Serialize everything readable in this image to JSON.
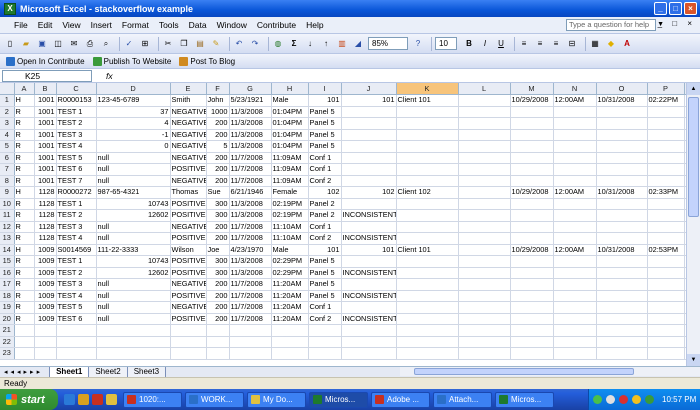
{
  "window": {
    "title": "Microsoft Excel - stackoverflow example"
  },
  "menu": [
    "File",
    "Edit",
    "View",
    "Insert",
    "Format",
    "Tools",
    "Data",
    "Window",
    "Contribute",
    "Help"
  ],
  "help_placeholder": "Type a question for help",
  "toolbar": {
    "zoom": "85%",
    "font_size": "10"
  },
  "contribute_bar": {
    "open": "Open In Contribute",
    "publish": "Publish To Website",
    "post": "Post To Blog"
  },
  "formula": {
    "name_box": "K25",
    "fx": "fx",
    "value": ""
  },
  "columns": [
    "A",
    "B",
    "C",
    "D",
    "E",
    "F",
    "G",
    "H",
    "I",
    "J",
    "K",
    "L",
    "M",
    "N",
    "O",
    "P",
    "Q"
  ],
  "selected_column": "K",
  "rows": [
    [
      "H",
      "1001",
      "R0000153",
      "123-45-6789",
      "Smith",
      "John",
      "5/23/1921",
      "Male",
      "101",
      "101",
      "Client 101",
      "",
      "10/29/2008",
      "12:00AM",
      "10/31/2008",
      "02:22PM",
      ""
    ],
    [
      "R",
      "1001",
      "TEST 1",
      "37",
      "NEGATIVE",
      "1000",
      "11/3/2008",
      "01:04PM",
      "Panel 5",
      "",
      "",
      "",
      "",
      "",
      "",
      "",
      ""
    ],
    [
      "R",
      "1001",
      "TEST 2",
      "4",
      "NEGATIVE",
      "200",
      "11/3/2008",
      "01:04PM",
      "Panel 5",
      "",
      "",
      "",
      "",
      "",
      "",
      "",
      ""
    ],
    [
      "R",
      "1001",
      "TEST 3",
      "-1",
      "NEGATIVE",
      "200",
      "11/3/2008",
      "01:04PM",
      "Panel 5",
      "",
      "",
      "",
      "",
      "",
      "",
      "",
      ""
    ],
    [
      "R",
      "1001",
      "TEST 4",
      "0",
      "NEGATIVE",
      "5",
      "11/3/2008",
      "01:04PM",
      "Panel 5",
      "",
      "",
      "",
      "",
      "",
      "",
      "",
      ""
    ],
    [
      "R",
      "1001",
      "TEST 5",
      "null",
      "NEGATIVE",
      "200",
      "11/7/2008",
      "11:09AM",
      "Conf 1",
      "",
      "",
      "",
      "",
      "",
      "",
      "",
      ""
    ],
    [
      "R",
      "1001",
      "TEST 6",
      "null",
      "POSITIVE",
      "200",
      "11/7/2008",
      "11:09AM",
      "Conf 1",
      "",
      "",
      "",
      "",
      "",
      "",
      "",
      ""
    ],
    [
      "R",
      "1001",
      "TEST 7",
      "null",
      "NEGATIVE",
      "200",
      "11/7/2008",
      "11:09AM",
      "Conf 2",
      "",
      "",
      "",
      "",
      "",
      "",
      "",
      ""
    ],
    [
      "H",
      "1128",
      "R0000272",
      "987-65-4321",
      "Thomas",
      "Sue",
      "6/21/1946",
      "Female",
      "102",
      "102",
      "Client 102",
      "",
      "10/29/2008",
      "12:00AM",
      "10/31/2008",
      "02:33PM",
      ""
    ],
    [
      "R",
      "1128",
      "TEST 1",
      "10743",
      "POSITIVE",
      "300",
      "11/3/2008",
      "02:19PM",
      "Panel 2",
      "",
      "",
      "",
      "",
      "",
      "",
      "",
      ""
    ],
    [
      "R",
      "1128",
      "TEST 2",
      "12602",
      "POSITIVE",
      "300",
      "11/3/2008",
      "02:19PM",
      "Panel 2",
      "INCONSISTENT",
      "",
      "",
      "",
      "",
      "",
      "",
      ""
    ],
    [
      "R",
      "1128",
      "TEST 3",
      "null",
      "NEGATIVE",
      "200",
      "11/7/2008",
      "11:10AM",
      "Conf 1",
      "",
      "",
      "",
      "",
      "",
      "",
      "",
      ""
    ],
    [
      "R",
      "1128",
      "TEST 4",
      "null",
      "POSITIVE",
      "200",
      "11/7/2008",
      "11:10AM",
      "Conf 2",
      "INCONSISTENT",
      "",
      "",
      "",
      "",
      "",
      "",
      ""
    ],
    [
      "H",
      "1009",
      "S0014569",
      "111-22-3333",
      "Wilson",
      "Joe",
      "4/23/1970",
      "Male",
      "101",
      "101",
      "Client 101",
      "",
      "10/29/2008",
      "12:00AM",
      "10/31/2008",
      "02:53PM",
      ""
    ],
    [
      "R",
      "1009",
      "TEST 1",
      "10743",
      "POSITIVE",
      "300",
      "11/3/2008",
      "02:29PM",
      "Panel 5",
      "",
      "",
      "",
      "",
      "",
      "",
      "",
      ""
    ],
    [
      "R",
      "1009",
      "TEST 2",
      "12602",
      "POSITIVE",
      "300",
      "11/3/2008",
      "02:29PM",
      "Panel 5",
      "INCONSISTENT",
      "",
      "",
      "",
      "",
      "",
      "",
      ""
    ],
    [
      "R",
      "1009",
      "TEST 3",
      "null",
      "NEGATIVE",
      "200",
      "11/7/2008",
      "11:20AM",
      "Panel 5",
      "",
      "",
      "",
      "",
      "",
      "",
      "",
      ""
    ],
    [
      "R",
      "1009",
      "TEST 4",
      "null",
      "POSITIVE",
      "200",
      "11/7/2008",
      "11:20AM",
      "Panel 5",
      "INCONSISTENT",
      "",
      "",
      "",
      "",
      "",
      "",
      ""
    ],
    [
      "R",
      "1009",
      "TEST 5",
      "null",
      "NEGATIVE",
      "200",
      "11/7/2008",
      "11:20AM",
      "Conf 1",
      "",
      "",
      "",
      "",
      "",
      "",
      "",
      ""
    ],
    [
      "R",
      "1009",
      "TEST 6",
      "null",
      "POSITIVE",
      "200",
      "11/7/2008",
      "11:20AM",
      "Conf 2",
      "INCONSISTENT",
      "",
      "",
      "",
      "",
      "",
      "",
      ""
    ],
    [
      "",
      "",
      "",
      "",
      "",
      "",
      "",
      "",
      "",
      "",
      "",
      "",
      "",
      "",
      "",
      "",
      ""
    ],
    [
      "",
      "",
      "",
      "",
      "",
      "",
      "",
      "",
      "",
      "",
      "",
      "",
      "",
      "",
      "",
      "",
      ""
    ],
    [
      "",
      "",
      "",
      "",
      "",
      "",
      "",
      "",
      "",
      "",
      "",
      "",
      "",
      "",
      "",
      "",
      ""
    ]
  ],
  "numeric_columns": [
    1,
    3,
    5,
    8,
    9
  ],
  "sheets": [
    "Sheet1",
    "Sheet2",
    "Sheet3"
  ],
  "status": "Ready",
  "taskbar": {
    "start": "start",
    "tasks": [
      "1020:...",
      "WORK...",
      "My Do...",
      "Micros...",
      "Adobe ...",
      "Attach...",
      "Micros..."
    ],
    "clock": "10:57 PM"
  }
}
